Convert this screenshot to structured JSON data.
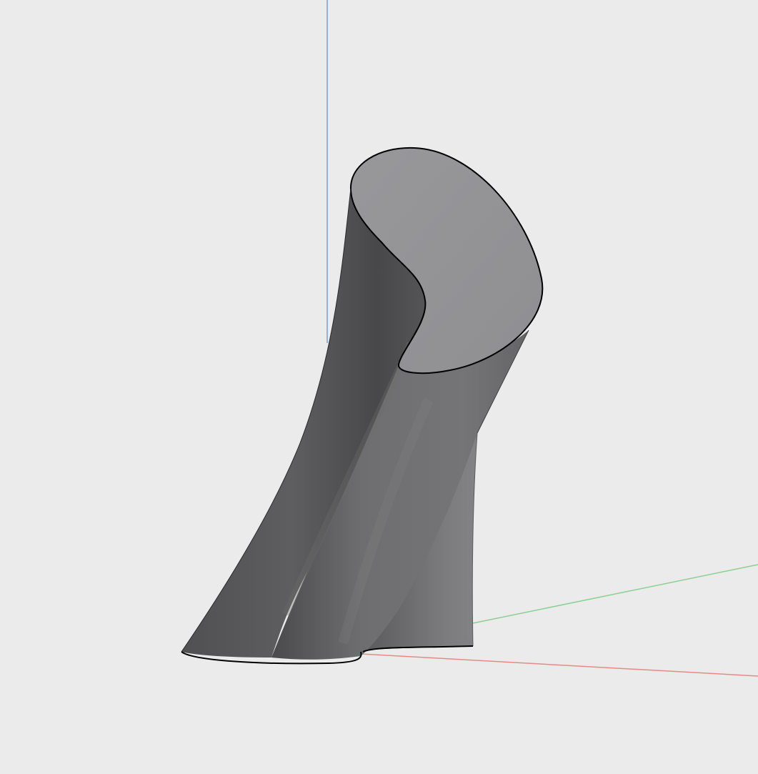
{
  "viewport": {
    "background_color": "#ebebeb"
  },
  "axes": {
    "x_axis_color": "#e88a84",
    "y_axis_color": "#8ccf92",
    "z_axis_color": "#6f9fe0"
  },
  "model": {
    "shape": "swept extruded solid",
    "top_face_color": "#939396",
    "side_dark_color": "#4c4c4e",
    "side_mid_color": "#6a6a6c",
    "side_light_color": "#88888a",
    "edge_color": "#000000"
  }
}
